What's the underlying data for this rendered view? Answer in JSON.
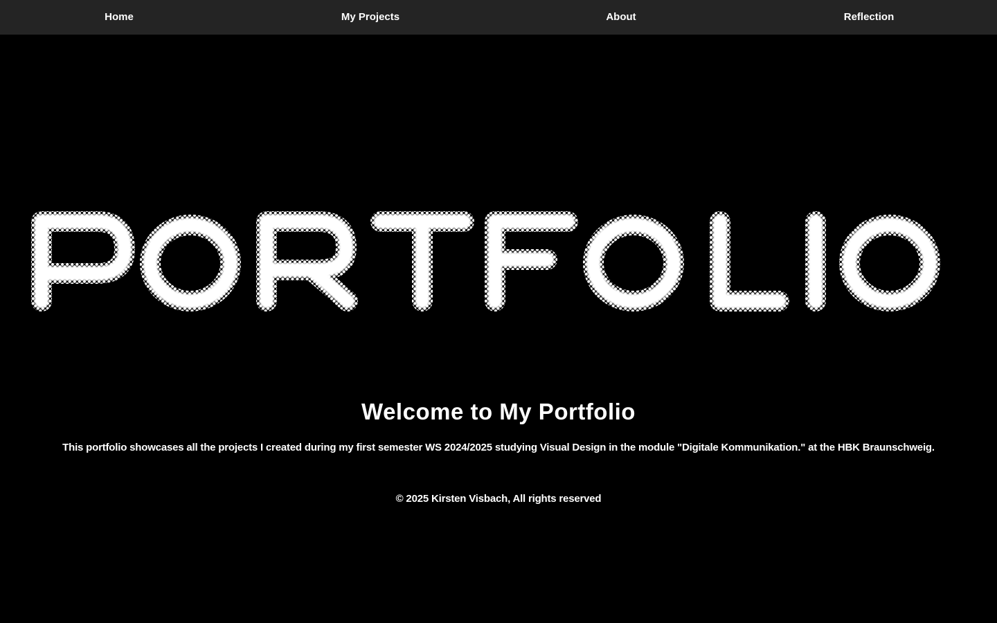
{
  "nav": {
    "items": [
      {
        "label": "Home"
      },
      {
        "label": "My Projects"
      },
      {
        "label": "About"
      },
      {
        "label": "Reflection"
      }
    ]
  },
  "hero": {
    "logo_text": "PORTFOLIO"
  },
  "main": {
    "title": "Welcome to My Portfolio",
    "intro": "This portfolio showcases all the projects I created during my first semester WS 2024/2025 studying Visual Design in the module \"Digitale Kommunikation.\" at the HBK Braunschweig."
  },
  "footer": {
    "copyright": "© 2025 Kirsten Visbach, All rights reserved"
  },
  "colors": {
    "background": "#000000",
    "navbar": "#242424",
    "text": "#ffffff"
  }
}
